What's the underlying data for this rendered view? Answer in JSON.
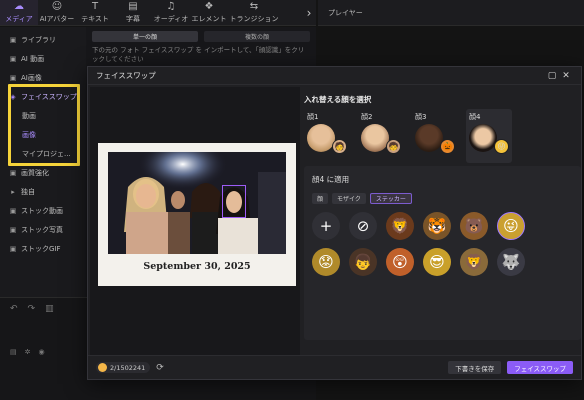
{
  "toolbar": {
    "tools": [
      {
        "label": "メディア",
        "icon": "media-icon",
        "glyph": "☁"
      },
      {
        "label": "AIアバター",
        "icon": "avatar-icon",
        "glyph": "☺"
      },
      {
        "label": "テキスト",
        "icon": "text-icon",
        "glyph": "T"
      },
      {
        "label": "字幕",
        "icon": "subtitle-icon",
        "glyph": "▤"
      },
      {
        "label": "オーディオ",
        "icon": "audio-icon",
        "glyph": "♫"
      },
      {
        "label": "エレメント",
        "icon": "element-icon",
        "glyph": "❖"
      },
      {
        "label": "トランジション",
        "icon": "transition-icon",
        "glyph": "⇆"
      }
    ]
  },
  "player": {
    "label": "プレイヤー"
  },
  "sidebar": {
    "items": [
      {
        "label": "ライブラリ"
      },
      {
        "label": "AI 動画"
      },
      {
        "label": "AI画像"
      },
      {
        "label": "フェイススワップ"
      },
      {
        "label": "動画"
      },
      {
        "label": "画像"
      },
      {
        "label": "マイプロジェ..."
      },
      {
        "label": "画質強化"
      },
      {
        "label": "独自"
      },
      {
        "label": "ストック動画"
      },
      {
        "label": "ストック写真"
      },
      {
        "label": "ストックGIF"
      }
    ]
  },
  "content": {
    "tabs": [
      "単一の顔",
      "複数の顔"
    ],
    "hint": "下の元の フォト フェイススワップ を インポートして、「顔認識」をクリックしてください"
  },
  "modal": {
    "title": "フェイススワップ",
    "photo_caption": "September 30, 2025",
    "select_title": "入れ替える顔を選択",
    "faces": [
      {
        "label": "顔1",
        "sub": "🧑"
      },
      {
        "label": "顔2",
        "sub": "🧒"
      },
      {
        "label": "顔3",
        "sub": "🎃"
      },
      {
        "label": "顔4",
        "sub": "😜"
      }
    ],
    "apply_title": "顔4 に適用",
    "filters": [
      "顔",
      "モザイク",
      "ステッカー"
    ],
    "stickers": [
      "+",
      "⊘",
      "🦁",
      "🐯",
      "🐻",
      "😜",
      "😟",
      "👦",
      "😲",
      "😎",
      "🦁",
      "🐺"
    ],
    "credits": "2/1502241",
    "save_draft": "下書きを保存",
    "swap_button": "フェイススワップ"
  }
}
